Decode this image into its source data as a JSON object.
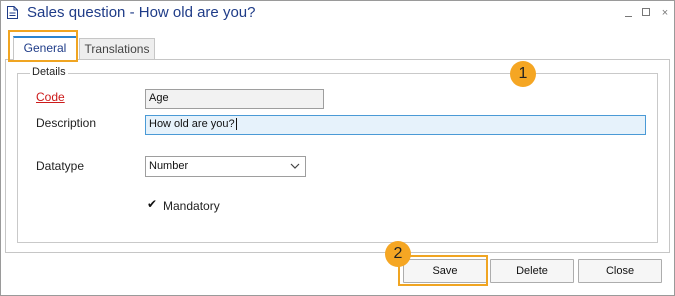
{
  "window": {
    "title": "Sales question - How old are you?",
    "controls": {
      "minimize": "minimize-icon",
      "maximize": "maximize-icon",
      "close": "×"
    }
  },
  "tabs": [
    {
      "label": "General",
      "active": true
    },
    {
      "label": "Translations",
      "active": false
    }
  ],
  "details": {
    "legend": "Details",
    "code_label": "Code",
    "code_value": "Age",
    "description_label": "Description",
    "description_value": "How old are you?",
    "datatype_label": "Datatype",
    "datatype_value": "Number",
    "mandatory_label": "Mandatory",
    "mandatory_checked": true,
    "mandatory_check_glyph": "✔"
  },
  "buttons": {
    "save": "Save",
    "delete": "Delete",
    "close": "Close"
  },
  "callouts": {
    "one": "1",
    "two": "2"
  },
  "colors": {
    "highlight": "#f0a522",
    "callout": "#f5a623",
    "title": "#1f3c88",
    "required": "#cc1a1a",
    "active_field": "#e6f2fb"
  }
}
